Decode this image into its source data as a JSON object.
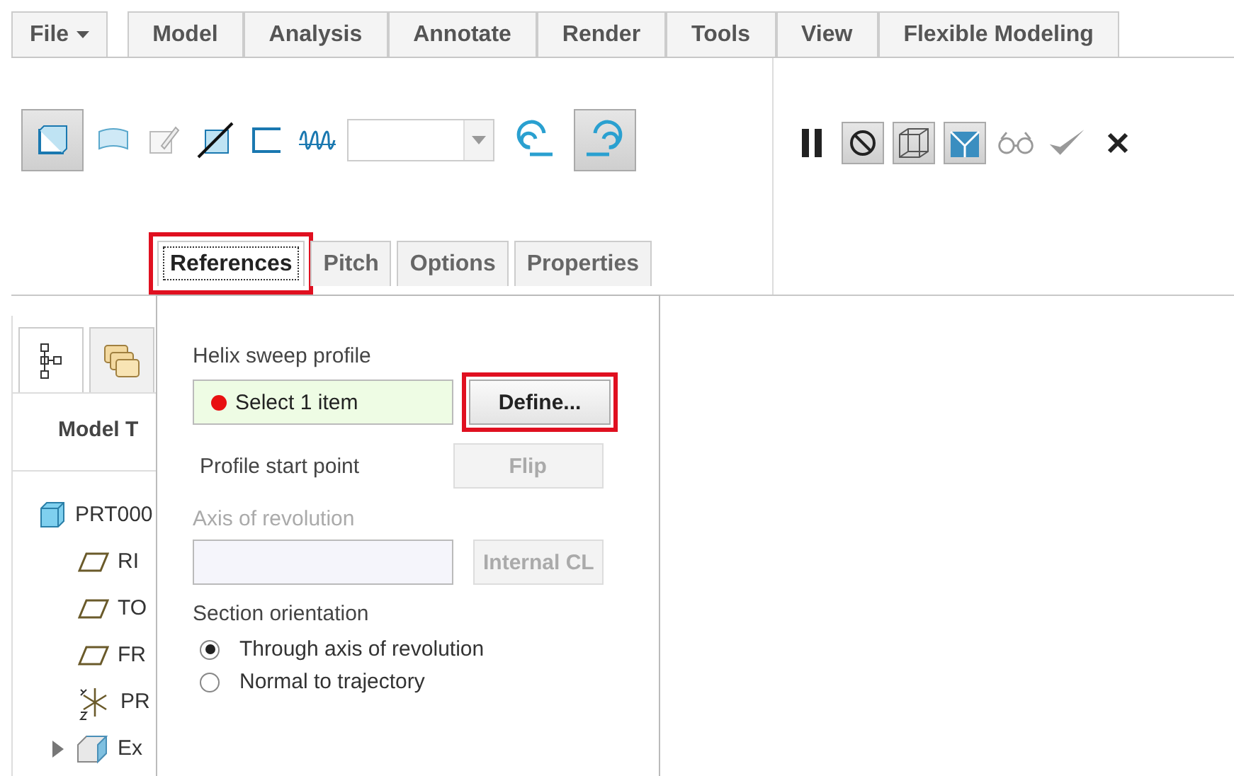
{
  "menu_tabs": [
    {
      "label": "File",
      "kind": "menu"
    },
    {
      "label": "Model",
      "kind": "tab"
    },
    {
      "label": "Analysis",
      "kind": "tab"
    },
    {
      "label": "Annotate",
      "kind": "tab"
    },
    {
      "label": "Render",
      "kind": "tab"
    },
    {
      "label": "Tools",
      "kind": "tab"
    },
    {
      "label": "View",
      "kind": "tab"
    },
    {
      "label": "Flexible Modeling",
      "kind": "tab"
    }
  ],
  "ribbon": {
    "left_tools": [
      {
        "kind": "solid",
        "selected": true
      },
      {
        "kind": "surface",
        "selected": false
      },
      {
        "kind": "sketch",
        "selected": false
      },
      {
        "kind": "remove",
        "selected": false
      },
      {
        "kind": "thicken",
        "selected": false
      },
      {
        "kind": "spring",
        "selected": false
      },
      {
        "kind": "combo"
      },
      {
        "kind": "left-hand",
        "selected": false
      },
      {
        "kind": "right-hand",
        "selected": true
      }
    ],
    "right_tools": [
      {
        "kind": "pause",
        "selected": false
      },
      {
        "kind": "no-preview",
        "selected": true
      },
      {
        "kind": "wire-preview",
        "selected": true
      },
      {
        "kind": "shaded-preview",
        "selected": true
      },
      {
        "kind": "glasses",
        "selected": false
      },
      {
        "kind": "check",
        "selected": false
      },
      {
        "kind": "cancel",
        "selected": false
      }
    ],
    "sub_tabs": [
      {
        "label": "References",
        "selected": true,
        "highlighted": true
      },
      {
        "label": "Pitch",
        "selected": false,
        "highlighted": false
      },
      {
        "label": "Options",
        "selected": false,
        "highlighted": false
      },
      {
        "label": "Properties",
        "selected": false,
        "highlighted": false
      }
    ]
  },
  "model_panel": {
    "tabs": [
      {
        "kind": "tree",
        "selected": true
      },
      {
        "kind": "layers",
        "selected": false
      }
    ],
    "title": "Model T",
    "tree": [
      {
        "text": "PRT000",
        "kind": "part",
        "children": [
          {
            "text": "RI",
            "kind": "plane"
          },
          {
            "text": "TO",
            "kind": "plane"
          },
          {
            "text": "FR",
            "kind": "plane"
          },
          {
            "text": "PR",
            "kind": "csys"
          },
          {
            "text": "Ex",
            "kind": "feature",
            "expanded": false
          }
        ]
      }
    ]
  },
  "references_panel": {
    "profile_label": "Helix sweep profile",
    "profile_collector": {
      "text": "Select 1 item",
      "color": "#e81010"
    },
    "define_button": {
      "label": "Define...",
      "highlighted": true
    },
    "start_point_label": "Profile start point",
    "flip_button": {
      "label": "Flip",
      "disabled": true
    },
    "axis_label": {
      "text": "Axis of revolution",
      "disabled": true
    },
    "internal_cl_button": {
      "label": "Internal CL",
      "disabled": true
    },
    "orientation_label": "Section orientation",
    "orientation_options": [
      {
        "label": "Through axis of revolution",
        "selected": true
      },
      {
        "label": "Normal to trajectory",
        "selected": false
      }
    ]
  }
}
